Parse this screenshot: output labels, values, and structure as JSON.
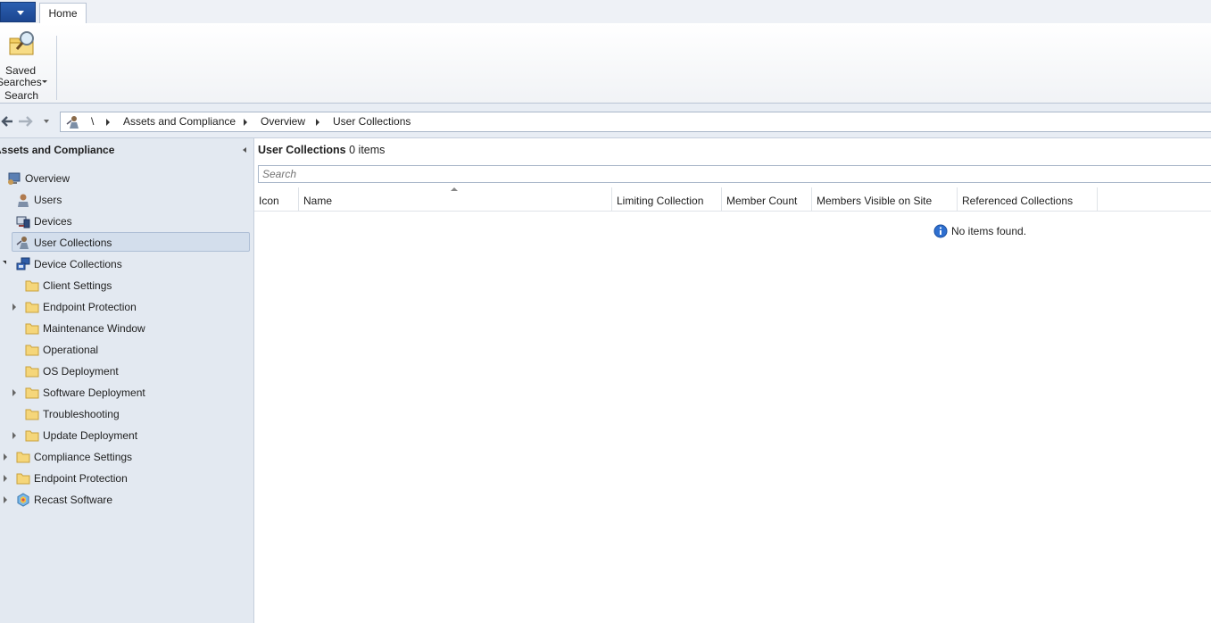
{
  "ribbon": {
    "tabs": [
      {
        "label": "Home"
      }
    ],
    "saved_searches": {
      "line1": "Saved",
      "line2": "Searches"
    },
    "group_label": "Search"
  },
  "breadcrumb": {
    "root": "\\",
    "items": [
      "Assets and Compliance",
      "Overview",
      "User Collections"
    ]
  },
  "nav": {
    "title": "Assets and Compliance",
    "items": [
      {
        "label": "Overview",
        "icon": "overview-icon"
      },
      {
        "label": "Users",
        "icon": "user-icon"
      },
      {
        "label": "Devices",
        "icon": "devices-icon"
      },
      {
        "label": "User Collections",
        "icon": "user-collections-icon",
        "selected": true
      },
      {
        "label": "Device Collections",
        "icon": "device-collections-icon",
        "expanded": true
      },
      {
        "label": "Client Settings",
        "icon": "folder-icon"
      },
      {
        "label": "Endpoint Protection",
        "icon": "folder-icon"
      },
      {
        "label": "Maintenance Window",
        "icon": "folder-icon"
      },
      {
        "label": "Operational",
        "icon": "folder-icon"
      },
      {
        "label": "OS Deployment",
        "icon": "folder-icon"
      },
      {
        "label": "Software Deployment",
        "icon": "folder-icon"
      },
      {
        "label": "Troubleshooting",
        "icon": "folder-icon"
      },
      {
        "label": "Update Deployment",
        "icon": "folder-icon"
      },
      {
        "label": "Compliance Settings",
        "icon": "folder-icon"
      },
      {
        "label": "Endpoint Protection",
        "icon": "folder-icon"
      },
      {
        "label": "Recast Software",
        "icon": "recast-icon"
      }
    ]
  },
  "content": {
    "title": "User Collections",
    "count": "0 items",
    "search_placeholder": "Search",
    "columns": [
      "Icon",
      "Name",
      "Limiting Collection",
      "Member Count",
      "Members Visible on Site",
      "Referenced Collections"
    ],
    "empty_message": "No items found."
  },
  "colors": {
    "accent": "#1c4690",
    "nav_bg": "#e3e9f1",
    "selected_bg": "#d3deec",
    "folder": "#f5d67a"
  }
}
